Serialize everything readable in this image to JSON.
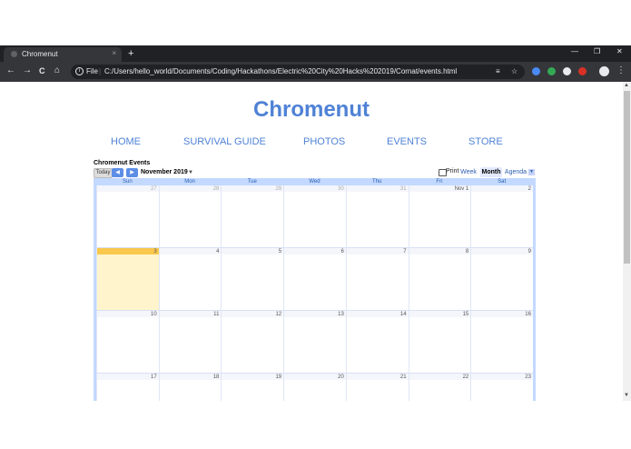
{
  "browser": {
    "tab_title": "Chromenut",
    "tab_close": "×",
    "new_tab": "+",
    "window_minimize": "—",
    "window_restore": "❐",
    "window_close": "✕",
    "back": "←",
    "forward": "→",
    "reload": "C",
    "home": "⌂",
    "info": "i",
    "scheme": "File",
    "url": "C:/Users/hello_world/Documents/Coding/Hackathons/Electric%20City%20Hacks%202019/Cornat/events.html",
    "reader_icon": "≡",
    "bookmark_icon": "☆",
    "menu": "⋮"
  },
  "site": {
    "title": "Chromenut",
    "nav": [
      "HOME",
      "SURVIVAL GUIDE",
      "PHOTOS",
      "EVENTS",
      "STORE"
    ]
  },
  "calendar": {
    "title": "Chromenut Events",
    "today_label": "Today",
    "prev": "◀",
    "next": "▶",
    "current_month": "November 2019",
    "month_drop": "▼",
    "print_label": "Print",
    "views": [
      "Week",
      "Month",
      "Agenda"
    ],
    "selected_view": "Month",
    "agenda_drop": "▼",
    "weekdays": [
      "Sun",
      "Mon",
      "Tue",
      "Wed",
      "Thu",
      "Fri",
      "Sat"
    ],
    "weeks": [
      [
        "27",
        "28",
        "29",
        "30",
        "31",
        "Nov 1",
        "2"
      ],
      [
        "3",
        "4",
        "5",
        "6",
        "7",
        "8",
        "9"
      ],
      [
        "10",
        "11",
        "12",
        "13",
        "14",
        "15",
        "16"
      ],
      [
        "17",
        "18",
        "19",
        "20",
        "21",
        "22",
        "23"
      ]
    ],
    "today_cell": "3",
    "colors": {
      "accent": "#4f82d6",
      "frame": "#c3d9ff",
      "today": "#fff4cc",
      "today_header": "#f9c84c"
    }
  }
}
